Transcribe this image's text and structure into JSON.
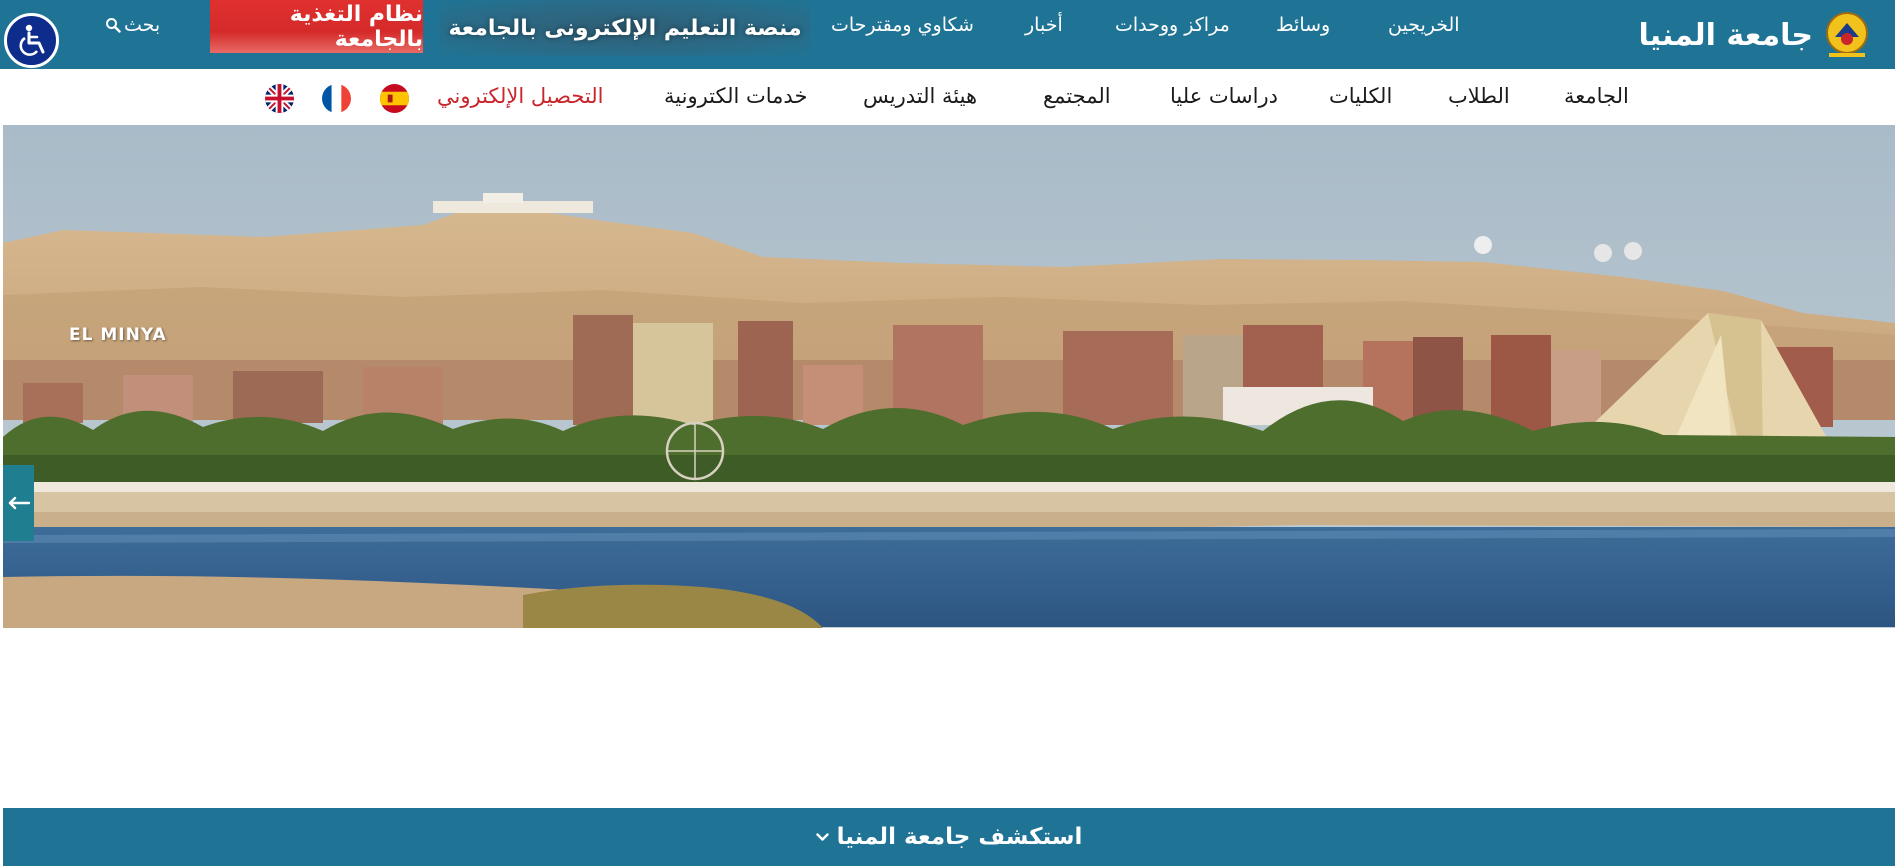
{
  "topbar": {
    "brand": {
      "title": "جامعة المنيا",
      "logo_icon": "university-logo-icon"
    },
    "links": {
      "graduates": "الخريجين",
      "media": "وسائط",
      "centers": "مراكز ووحدات",
      "news": "أخبار",
      "complaints": "شكاوي ومقترحات"
    },
    "elearning_label": "منصة التعليم الإلكترونى بالجامعة",
    "feeding_label": "نظام التغذية بالجامعة",
    "search_label": "بحث",
    "search_icon": "search-icon",
    "accessibility_icon": "wheelchair-icon"
  },
  "mainnav": {
    "items": {
      "university": "الجامعة",
      "students": "الطلاب",
      "colleges": "الكليات",
      "postgrad": "دراسات عليا",
      "community": "المجتمع",
      "staff": "هيئة التدريس",
      "eservices": "خدمات الكترونية",
      "epayment": "التحصيل الإلكتروني"
    },
    "flags": [
      "spanish-flag-icon",
      "french-flag-icon",
      "english-flag-icon"
    ]
  },
  "hero": {
    "caption": "EL MINYA",
    "side_tab_icon": "arrow-left-icon"
  },
  "explore": {
    "label": "استكشف جامعة المنيا",
    "icon": "chevron-down-icon"
  },
  "colors": {
    "primary": "#1f7495",
    "feeding_red": "#d42a2a",
    "active_link": "#c8262b",
    "accessibility_blue": "#0d2c8c"
  }
}
